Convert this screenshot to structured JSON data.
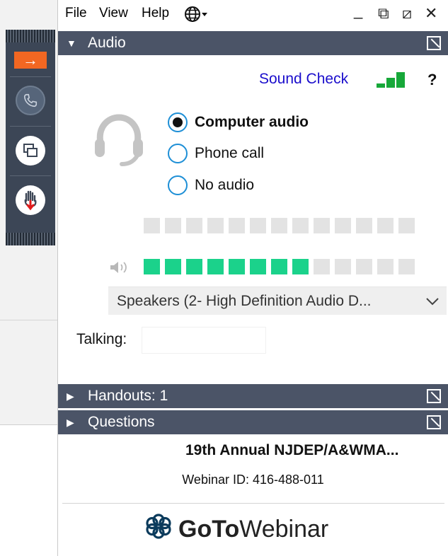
{
  "menu": {
    "file": "File",
    "view": "View",
    "help": "Help",
    "globe_icon": "globe-icon",
    "minimize": "_",
    "restore": "⧉",
    "popout": "⧄",
    "close": "✕"
  },
  "sidebar": {
    "arrow": "→",
    "icons": [
      "arrow-right-icon",
      "phone-icon",
      "screens-icon",
      "raise-hand-icon"
    ]
  },
  "audio": {
    "header": "Audio",
    "sound_check": "Sound Check",
    "help": "?",
    "options": [
      {
        "label": "Computer audio",
        "checked": true
      },
      {
        "label": "Phone call",
        "checked": false
      },
      {
        "label": "No audio",
        "checked": false
      }
    ],
    "mic_level": 0,
    "speaker_level": 8,
    "meter_segments": 13,
    "speaker_device": "Speakers (2- High Definition Audio D...",
    "talking_label": "Talking:",
    "talking_value": ""
  },
  "panels": {
    "handouts": "Handouts: 1",
    "questions": "Questions"
  },
  "info": {
    "title": "19th Annual NJDEP/A&WMA...",
    "webinar_id": "Webinar ID: 416-488-011"
  },
  "brand": {
    "goto": "GoTo",
    "webinar": "Webinar"
  },
  "colors": {
    "header_bg": "#4b5467",
    "accent_orange": "#f26722",
    "meter_on": "#1bd28b",
    "signal_green": "#17a839",
    "link_blue": "#1a0dcc"
  }
}
